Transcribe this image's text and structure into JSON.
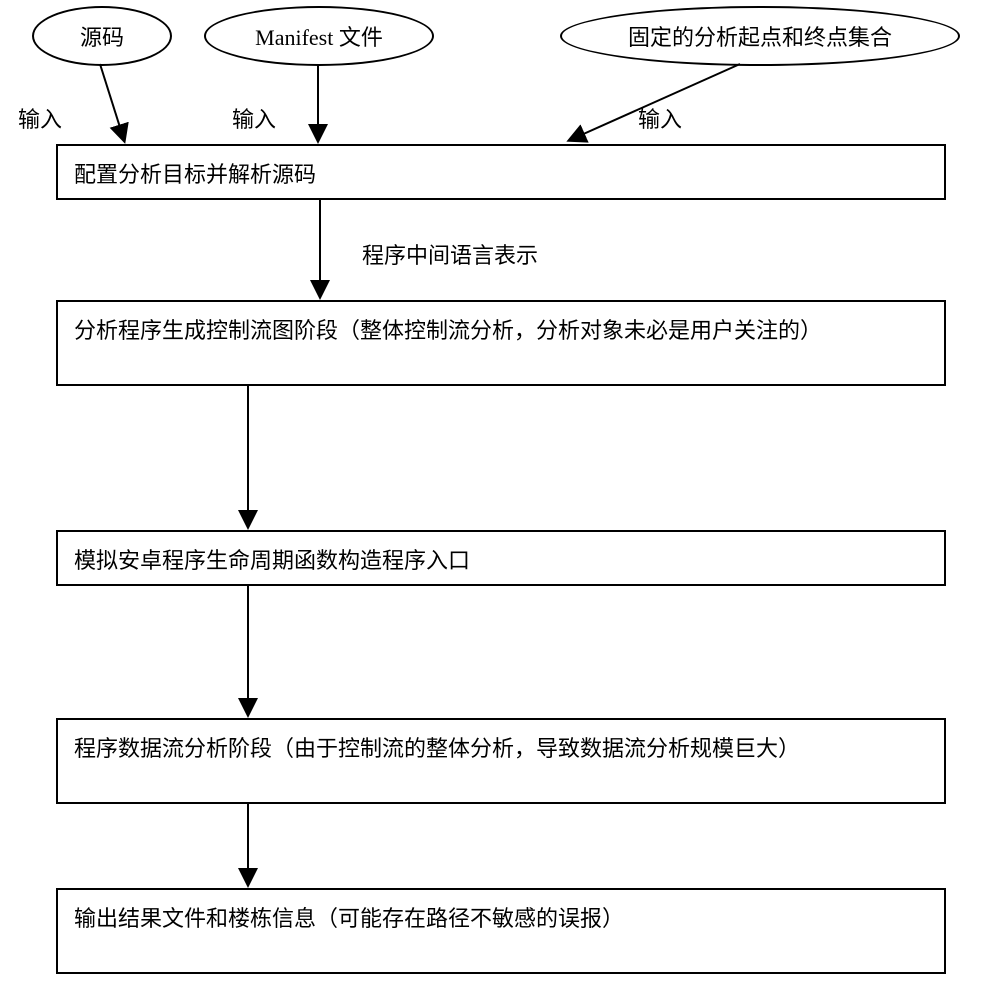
{
  "ellipses": {
    "source": "源码",
    "manifest": "Manifest 文件",
    "fixed_set": "固定的分析起点和终点集合"
  },
  "input_labels": {
    "left": "输入",
    "center": "输入",
    "right": "输入"
  },
  "intermediate_label": "程序中间语言表示",
  "steps": {
    "step1": "配置分析目标并解析源码",
    "step2": "分析程序生成控制流图阶段（整体控制流分析，分析对象未必是用户关注的）",
    "step3": "模拟安卓程序生命周期函数构造程序入口",
    "step4": "程序数据流分析阶段（由于控制流的整体分析，导致数据流分析规模巨大）",
    "step5": "输出结果文件和楼栋信息（可能存在路径不敏感的误报）"
  }
}
